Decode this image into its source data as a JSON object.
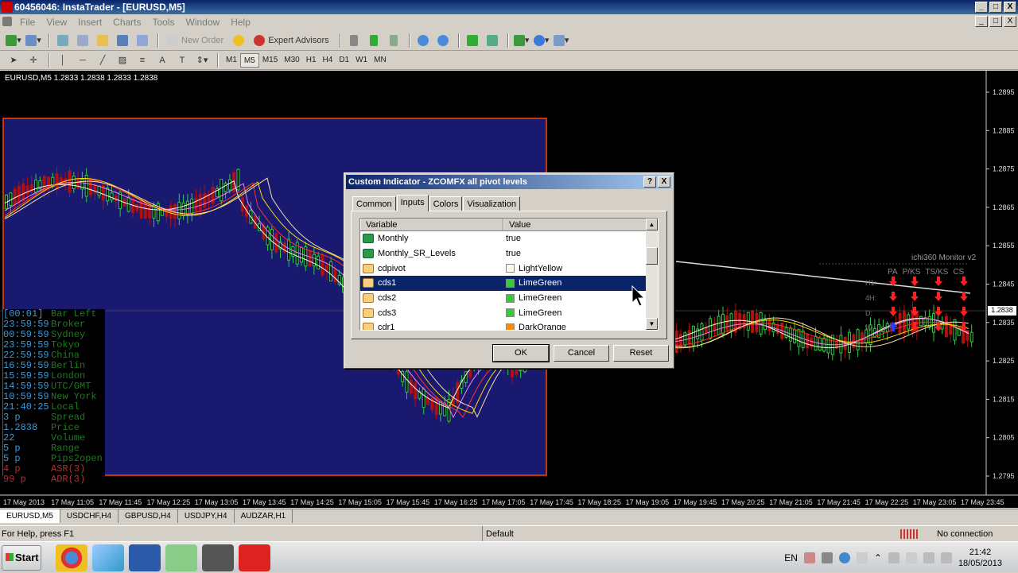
{
  "window": {
    "title": "60456046: InstaTrader - [EURUSD,M5]",
    "controls": [
      "_",
      "□",
      "X"
    ]
  },
  "menu": [
    "File",
    "View",
    "Insert",
    "Charts",
    "Tools",
    "Window",
    "Help"
  ],
  "toolbar": {
    "new_order": "New Order",
    "expert_advisors": "Expert Advisors"
  },
  "timeframes": [
    "M1",
    "M5",
    "M15",
    "M30",
    "H1",
    "H4",
    "D1",
    "W1",
    "MN"
  ],
  "active_timeframe": "M5",
  "chart": {
    "header": "EURUSD,M5  1.2833 1.2838 1.2833 1.2838",
    "price_labels": [
      "1.2895",
      "1.2885",
      "1.2875",
      "1.2865",
      "1.2855",
      "1.2845",
      "1.2835",
      "1.2825",
      "1.2815",
      "1.2805",
      "1.2795"
    ],
    "current_price": "1.2838",
    "time_labels": [
      "17 May 2013",
      "17 May 11:05",
      "17 May 11:45",
      "17 May 12:25",
      "17 May 13:05",
      "17 May 13:45",
      "17 May 14:25",
      "17 May 15:05",
      "17 May 15:45",
      "17 May 16:25",
      "17 May 17:05",
      "17 May 17:45",
      "17 May 18:25",
      "17 May 19:05",
      "17 May 19:45",
      "17 May 20:25",
      "17 May 21:05",
      "17 May 21:45",
      "17 May 22:25",
      "17 May 23:05",
      "17 May 23:45"
    ],
    "sessions": [
      {
        "time": "[00:01]",
        "label": "Bar Left"
      },
      {
        "time": "23:59:59",
        "label": "Broker"
      },
      {
        "time": "00:59:59",
        "label": "Sydney"
      },
      {
        "time": "23:59:59",
        "label": "Tokyo"
      },
      {
        "time": "22:59:59",
        "label": "China"
      },
      {
        "time": "16:59:59",
        "label": "Berlin"
      },
      {
        "time": "15:59:59",
        "label": "London"
      },
      {
        "time": "14:59:59",
        "label": "UTC/GMT"
      },
      {
        "time": "10:59:59",
        "label": "New York"
      },
      {
        "time": "21:40:25",
        "label": "Local"
      },
      {
        "time": "3 p",
        "label": "Spread"
      },
      {
        "time": "1.2838",
        "label": "Price"
      },
      {
        "time": "22",
        "label": "Volume"
      },
      {
        "time": "5 p",
        "label": "Range"
      },
      {
        "time": "5 p",
        "label": "Pips2open"
      },
      {
        "time": "4 p",
        "label": "ASR(3)"
      },
      {
        "time": "99 p",
        "label": "ADR(3)"
      }
    ],
    "ichi_monitor": {
      "title": "ichi360 Monitor v2",
      "columns": [
        "PA",
        "P/KS",
        "TS/KS",
        "CS"
      ],
      "rows": [
        "H1:",
        "4H:",
        "D:",
        "W:"
      ]
    }
  },
  "dialog": {
    "title": "Custom Indicator - ZCOMFX all pivot levels",
    "tabs": [
      "Common",
      "Inputs",
      "Colors",
      "Visualization"
    ],
    "active_tab": "Inputs",
    "columns": [
      "Variable",
      "Value"
    ],
    "rows": [
      {
        "variable": "Monthly",
        "value": "true",
        "icon": "bool",
        "swatch": ""
      },
      {
        "variable": "Monthly_SR_Levels",
        "value": "true",
        "icon": "bool",
        "swatch": ""
      },
      {
        "variable": "cdpivot",
        "value": "LightYellow",
        "icon": "color",
        "swatch": "#ffffe0"
      },
      {
        "variable": "cds1",
        "value": "LimeGreen",
        "icon": "color",
        "swatch": "#32cd32"
      },
      {
        "variable": "cds2",
        "value": "LimeGreen",
        "icon": "color",
        "swatch": "#32cd32"
      },
      {
        "variable": "cds3",
        "value": "LimeGreen",
        "icon": "color",
        "swatch": "#32cd32"
      },
      {
        "variable": "cdr1",
        "value": "DarkOrange",
        "icon": "color",
        "swatch": "#ff8c00"
      }
    ],
    "selected_row": 3,
    "buttons": {
      "ok": "OK",
      "cancel": "Cancel",
      "reset": "Reset"
    }
  },
  "chart_tabs": [
    "EURUSD,M5",
    "USDCHF,H4",
    "GBPUSD,H4",
    "USDJPY,H4",
    "AUDZAR,H1"
  ],
  "status": {
    "help": "For Help, press F1",
    "profile": "Default",
    "connection": "No connection"
  },
  "taskbar": {
    "start": "Start",
    "lang": "EN",
    "time": "21:42",
    "date": "18/05/2013"
  }
}
